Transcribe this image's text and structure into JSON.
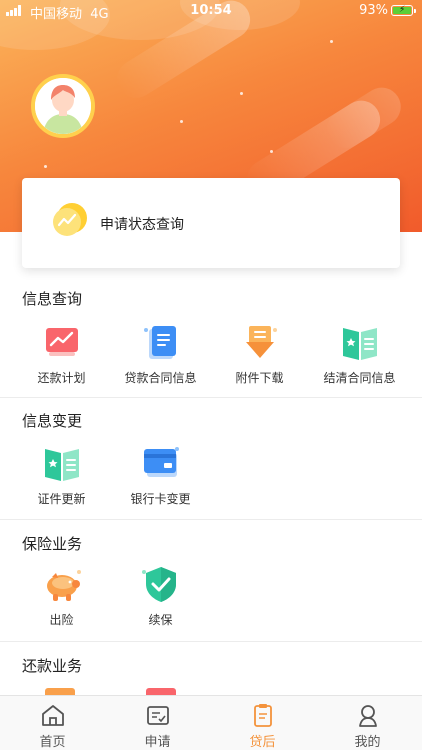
{
  "status_bar": {
    "carrier": "中国移动",
    "network": "4G",
    "time": "10:54",
    "battery": "93%"
  },
  "colors": {
    "accent": "#f4933c",
    "gradient_start": "#fbb45a",
    "gradient_end": "#f15b2b"
  },
  "query_card": {
    "label": "申请状态查询",
    "icon": "chart-bubble-icon"
  },
  "sections": {
    "info_query": {
      "title": "信息查询",
      "items": [
        {
          "label": "还款计划",
          "icon": "trend-chart-icon"
        },
        {
          "label": "贷款合同信息",
          "icon": "document-icon"
        },
        {
          "label": "附件下载",
          "icon": "download-icon"
        },
        {
          "label": "结清合同信息",
          "icon": "open-book-icon"
        }
      ]
    },
    "info_change": {
      "title": "信息变更",
      "items": [
        {
          "label": "证件更新",
          "icon": "id-book-icon"
        },
        {
          "label": "银行卡变更",
          "icon": "bank-card-icon"
        }
      ]
    },
    "insurance": {
      "title": "保险业务",
      "items": [
        {
          "label": "出险",
          "icon": "piggy-bank-icon"
        },
        {
          "label": "续保",
          "icon": "shield-check-icon"
        }
      ]
    },
    "repayment": {
      "title": "还款业务"
    }
  },
  "tabbar": {
    "items": [
      {
        "label": "首页",
        "icon": "home-icon",
        "active": false
      },
      {
        "label": "申请",
        "icon": "apply-form-icon",
        "active": false
      },
      {
        "label": "贷后",
        "icon": "clipboard-icon",
        "active": true
      },
      {
        "label": "我的",
        "icon": "user-icon",
        "active": false
      }
    ]
  }
}
